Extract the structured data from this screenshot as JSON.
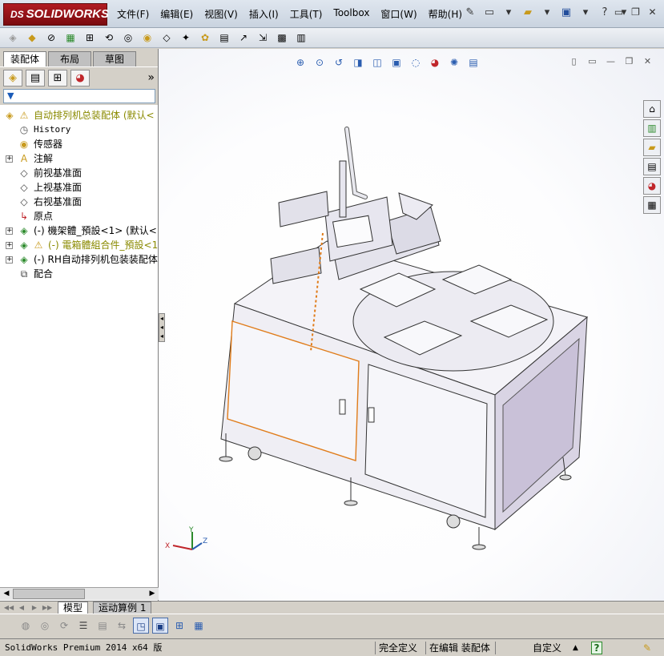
{
  "app": {
    "logo_prefix": "DS",
    "logo_text": "SOLIDWORKS"
  },
  "menu": [
    "文件(F)",
    "编辑(E)",
    "视图(V)",
    "插入(I)",
    "工具(T)",
    "Toolbox",
    "窗口(W)",
    "帮助(H)"
  ],
  "feature_manager": {
    "tabs": [
      "装配体",
      "布局",
      "草图"
    ],
    "active_tab": "装配体",
    "expand_arrow": "»",
    "tree": [
      {
        "label": "自动排列机总装配体  (默认<",
        "icon": "assembly-icon",
        "warn": true,
        "level": 0
      },
      {
        "label": "History",
        "icon": "history-icon",
        "level": 1
      },
      {
        "label": "传感器",
        "icon": "sensor-icon",
        "level": 1
      },
      {
        "label": "注解",
        "icon": "annotation-icon",
        "level": 1,
        "expandable": true
      },
      {
        "label": "前视基准面",
        "icon": "plane-icon",
        "level": 1
      },
      {
        "label": "上视基准面",
        "icon": "plane-icon",
        "level": 1
      },
      {
        "label": "右视基准面",
        "icon": "plane-icon",
        "level": 1
      },
      {
        "label": "原点",
        "icon": "origin-icon",
        "level": 1
      },
      {
        "label": "(-) 機架體_預設<1> (默认<",
        "icon": "subassembly-icon",
        "level": 1,
        "expandable": true
      },
      {
        "label": "(-) 電箱體組合件_預設<1",
        "icon": "subassembly-icon",
        "level": 1,
        "expandable": true,
        "warn": true
      },
      {
        "label": "(-) RH自动排列机包装装配体",
        "icon": "subassembly-icon",
        "level": 1,
        "expandable": true
      },
      {
        "label": "配合",
        "icon": "mates-icon",
        "level": 1
      }
    ]
  },
  "bottom_tabs": [
    "模型",
    "运动算例 1"
  ],
  "status": {
    "product": "SolidWorks Premium 2014 x64 版",
    "definition": "完全定义",
    "editing": "在编辑 装配体",
    "units": "自定义",
    "help": "?"
  },
  "colors": {
    "logo_red": "#a3161c",
    "selection_orange": "#e07c1a",
    "accent_blue": "#2a5db0"
  }
}
